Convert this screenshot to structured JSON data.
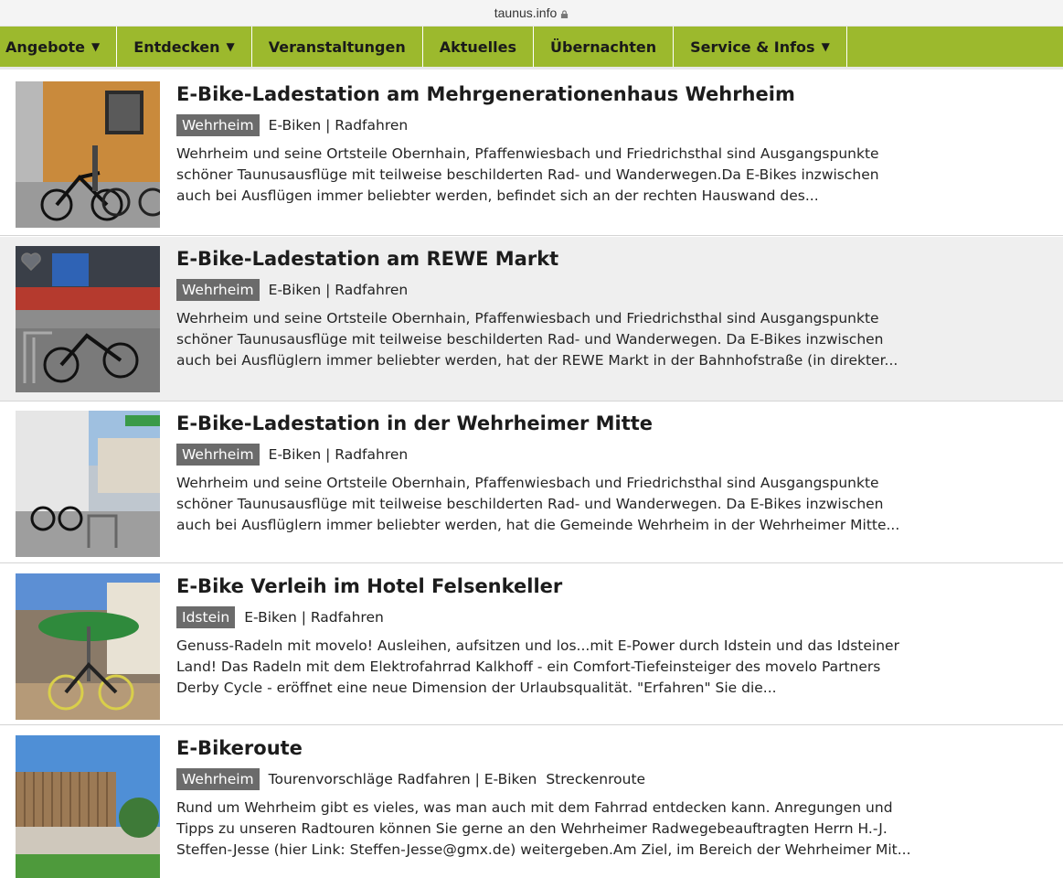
{
  "browser": {
    "url": "taunus.info"
  },
  "nav": {
    "items": [
      {
        "label": "Angebote",
        "dropdown": true
      },
      {
        "label": "Entdecken",
        "dropdown": true
      },
      {
        "label": "Veranstaltungen",
        "dropdown": false
      },
      {
        "label": "Aktuelles",
        "dropdown": false
      },
      {
        "label": "Übernachten",
        "dropdown": false
      },
      {
        "label": "Service & Infos",
        "dropdown": true
      }
    ],
    "accent_color": "#9cb92d"
  },
  "entries": [
    {
      "title": "E-Bike-Ladestation am Mehrgenerationenhaus Wehrheim",
      "tag": "Wehrheim",
      "categories": "E-Biken | Radfahren",
      "extra": "",
      "description": [
        "Wehrheim und seine Ortsteile Obernhain, Pfaffenwiesbach und Friedrichsthal sind Ausgangspunkte",
        "schöner Taunusausflüge mit teilweise beschilderten Rad- und Wanderwegen.Da E-Bikes inzwischen",
        "auch bei Ausflügen immer beliebter werden, befindet sich an der rechten Hauswand des..."
      ]
    },
    {
      "title": "E-Bike-Ladestation am REWE Markt",
      "tag": "Wehrheim",
      "categories": "E-Biken | Radfahren",
      "extra": "",
      "favorite_icon": "heart-outline-icon",
      "description": [
        "Wehrheim und seine Ortsteile Obernhain, Pfaffenwiesbach und Friedrichsthal sind Ausgangspunkte",
        "schöner Taunusausflüge mit teilweise beschilderten Rad- und Wanderwegen. Da E-Bikes inzwischen",
        "auch bei Ausflüglern immer beliebter werden, hat der REWE Markt in der Bahnhofstraße (in direkter..."
      ]
    },
    {
      "title": "E-Bike-Ladestation in der Wehrheimer Mitte",
      "tag": "Wehrheim",
      "categories": "E-Biken | Radfahren",
      "extra": "",
      "description": [
        "Wehrheim und seine Ortsteile Obernhain, Pfaffenwiesbach und Friedrichsthal sind Ausgangspunkte",
        "schöner Taunusausflüge mit teilweise beschilderten Rad- und Wanderwegen. Da E-Bikes inzwischen",
        "auch bei Ausflüglern immer beliebter werden, hat die Gemeinde Wehrheim in der Wehrheimer Mitte..."
      ]
    },
    {
      "title": "E-Bike Verleih im Hotel Felsenkeller",
      "tag": "Idstein",
      "categories": "E-Biken | Radfahren",
      "extra": "",
      "description": [
        "Genuss-Radeln mit movelo! Ausleihen, aufsitzen und los...mit E-Power durch Idstein und das Idsteiner",
        "Land! Das Radeln mit dem Elektrofahrrad Kalkhoff - ein Comfort-Tiefeinsteiger des movelo Partners",
        "Derby Cycle - eröffnet eine neue Dimension der Urlaubsqualität. \"Erfahren\" Sie die..."
      ]
    },
    {
      "title": "E-Bikeroute",
      "tag": "Wehrheim",
      "categories": "Tourenvorschläge Radfahren | E-Biken",
      "extra": "Streckenroute",
      "description": [
        "Rund um Wehrheim gibt es vieles, was man auch mit dem Fahrrad entdecken kann. Anregungen und",
        "Tipps zu unseren Radtouren können Sie gerne an den Wehrheimer Radwegebeauftragten Herrn H.-J.",
        "Steffen-Jesse (hier Link: Steffen-Jesse@gmx.de) weitergeben.Am Ziel, im Bereich der Wehrheimer Mit..."
      ]
    }
  ]
}
